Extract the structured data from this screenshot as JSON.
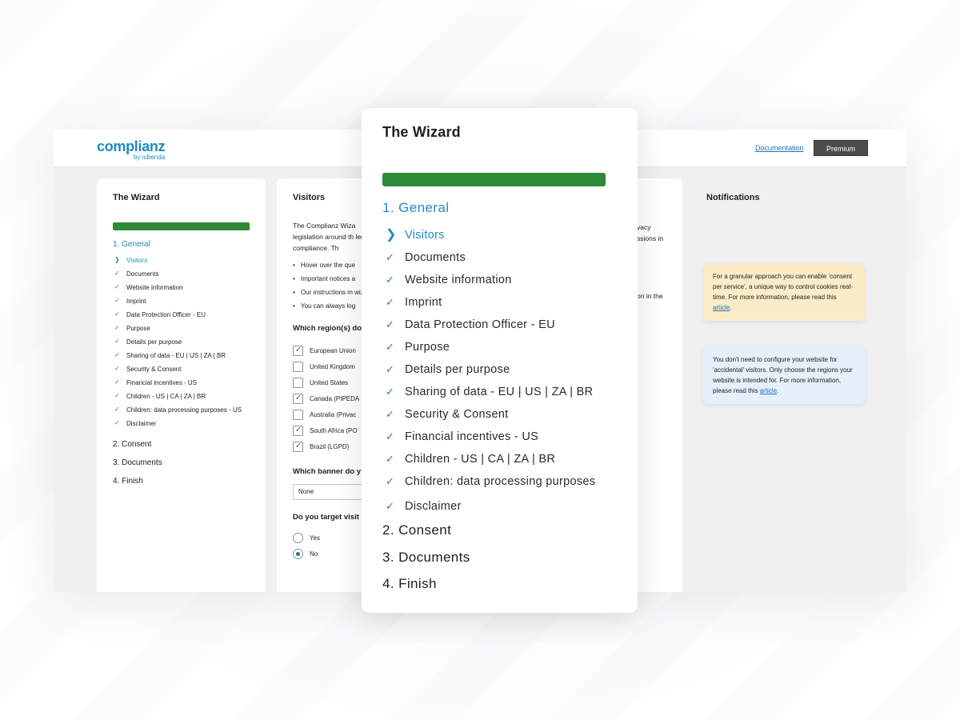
{
  "brand": {
    "name": "complianz",
    "sub": "by iubenda"
  },
  "topbar": {
    "documentation": "Documentation",
    "premium": "Premium"
  },
  "wizard": {
    "title": "The Wizard",
    "steps": [
      {
        "label": "1. General",
        "active": true
      },
      {
        "label": "2. Consent"
      },
      {
        "label": "3. Documents"
      },
      {
        "label": "4. Finish"
      }
    ],
    "general_items": [
      "Visitors",
      "Documents",
      "Website information",
      "Imprint",
      "Data Protection Officer - EU",
      "Purpose",
      "Details per purpose",
      "Sharing of data - EU | US | ZA | BR",
      "Security & Consent",
      "Financial incentives - US",
      "Children - US | CA | ZA | BR",
      "Children: data processing purposes - US",
      "Disclaimer"
    ],
    "zoom_children_label": "Children: data processing purposes"
  },
  "visitors": {
    "title": "Visitors",
    "intro": "The Complianz Wiza legislation around th legal compliance. Th",
    "intro_right": "vacy ssions in",
    "bullets": [
      "Hover over the que",
      "Important notices a",
      "Our instructions m wizard.",
      "You can always log"
    ],
    "bullet_right": "on in the",
    "regions_question": "Which region(s) do",
    "regions": [
      {
        "label": "European Union",
        "checked": true
      },
      {
        "label": "United Kingdom",
        "checked": false
      },
      {
        "label": "United States",
        "checked": false
      },
      {
        "label": "Canada (PIPEDA",
        "checked": true
      },
      {
        "label": "Australia (Privac",
        "checked": false
      },
      {
        "label": "South Africa (PO",
        "checked": true
      },
      {
        "label": "Brazil (LGPD)",
        "checked": true
      }
    ],
    "banner_question": "Which banner do y",
    "banner_value": "None",
    "target_question": "Do you target visit",
    "target_options": [
      {
        "label": "Yes",
        "selected": false
      },
      {
        "label": "No",
        "selected": true
      }
    ]
  },
  "notifications": {
    "title": "Notifications",
    "yellow_text": "For a granular approach you can enable 'consent per service', a unique way to control cookies real-time. For more information, please read this ",
    "blue_text": "You don't need to configure your website for 'accidental' visitors. Only choose the regions your website is intended for. For more information, please read this ",
    "link": "article"
  },
  "colors": {
    "accent": "#1e8cbe",
    "progress": "#2e8a37",
    "yellow": "#fbecc8",
    "blue": "#e6effa"
  },
  "icons": {
    "current": "chevron-right-icon",
    "done": "check-icon"
  }
}
